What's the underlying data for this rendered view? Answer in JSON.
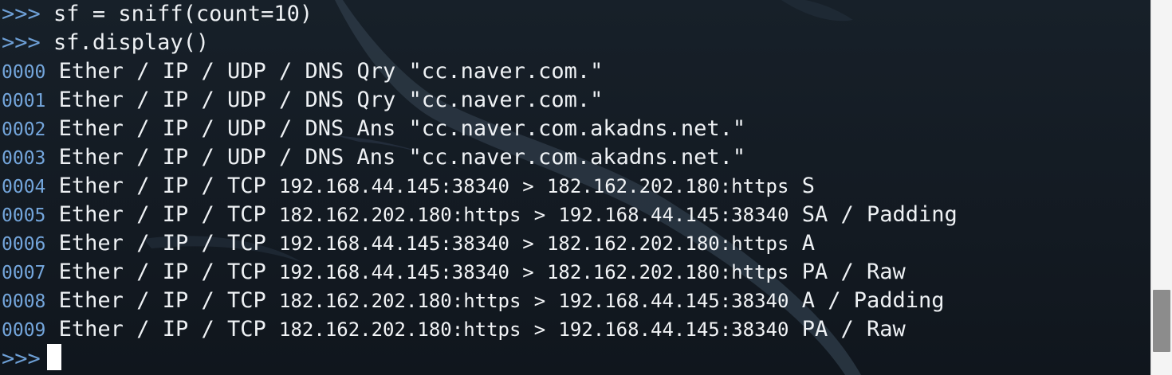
{
  "terminal": {
    "prompt": ">>>",
    "commands": [
      "sf = sniff(count=10)",
      "sf.display()"
    ],
    "packets": [
      {
        "index": "0000",
        "layers": "Ether / IP / UDP / DNS Qry",
        "src": "",
        "arrow": "",
        "dst": "",
        "info": " \"cc.naver.com.\""
      },
      {
        "index": "0001",
        "layers": "Ether / IP / UDP / DNS Qry",
        "src": "",
        "arrow": "",
        "dst": "",
        "info": " \"cc.naver.com.\""
      },
      {
        "index": "0002",
        "layers": "Ether / IP / UDP / DNS Ans",
        "src": "",
        "arrow": "",
        "dst": "",
        "info": " \"cc.naver.com.akadns.net.\""
      },
      {
        "index": "0003",
        "layers": "Ether / IP / UDP / DNS Ans",
        "src": "",
        "arrow": "",
        "dst": "",
        "info": " \"cc.naver.com.akadns.net.\""
      },
      {
        "index": "0004",
        "layers": "Ether / IP / TCP",
        "src": "192.168.44.145:38340",
        "arrow": ">",
        "dst": "182.162.202.180:https",
        "info": "S"
      },
      {
        "index": "0005",
        "layers": "Ether / IP / TCP",
        "src": "182.162.202.180:https",
        "arrow": ">",
        "dst": "192.168.44.145:38340",
        "info": "SA / Padding"
      },
      {
        "index": "0006",
        "layers": "Ether / IP / TCP",
        "src": "192.168.44.145:38340",
        "arrow": ">",
        "dst": "182.162.202.180:https",
        "info": "A"
      },
      {
        "index": "0007",
        "layers": "Ether / IP / TCP",
        "src": "192.168.44.145:38340",
        "arrow": ">",
        "dst": "182.162.202.180:https",
        "info": "PA / Raw"
      },
      {
        "index": "0008",
        "layers": "Ether / IP / TCP",
        "src": "182.162.202.180:https",
        "arrow": ">",
        "dst": "192.168.44.145:38340",
        "info": "A / Padding"
      },
      {
        "index": "0009",
        "layers": "Ether / IP / TCP",
        "src": "182.162.202.180:https",
        "arrow": ">",
        "dst": "192.168.44.145:38340",
        "info": "PA / Raw"
      }
    ]
  },
  "colors": {
    "background": "#151b22",
    "text": "#eef1f4",
    "prompt": "#6d9fd6",
    "index": "#74a6dc"
  },
  "icons": {
    "background": "kali-dragon-watermark"
  },
  "scrollbar": {
    "position_fraction": 0.82
  }
}
